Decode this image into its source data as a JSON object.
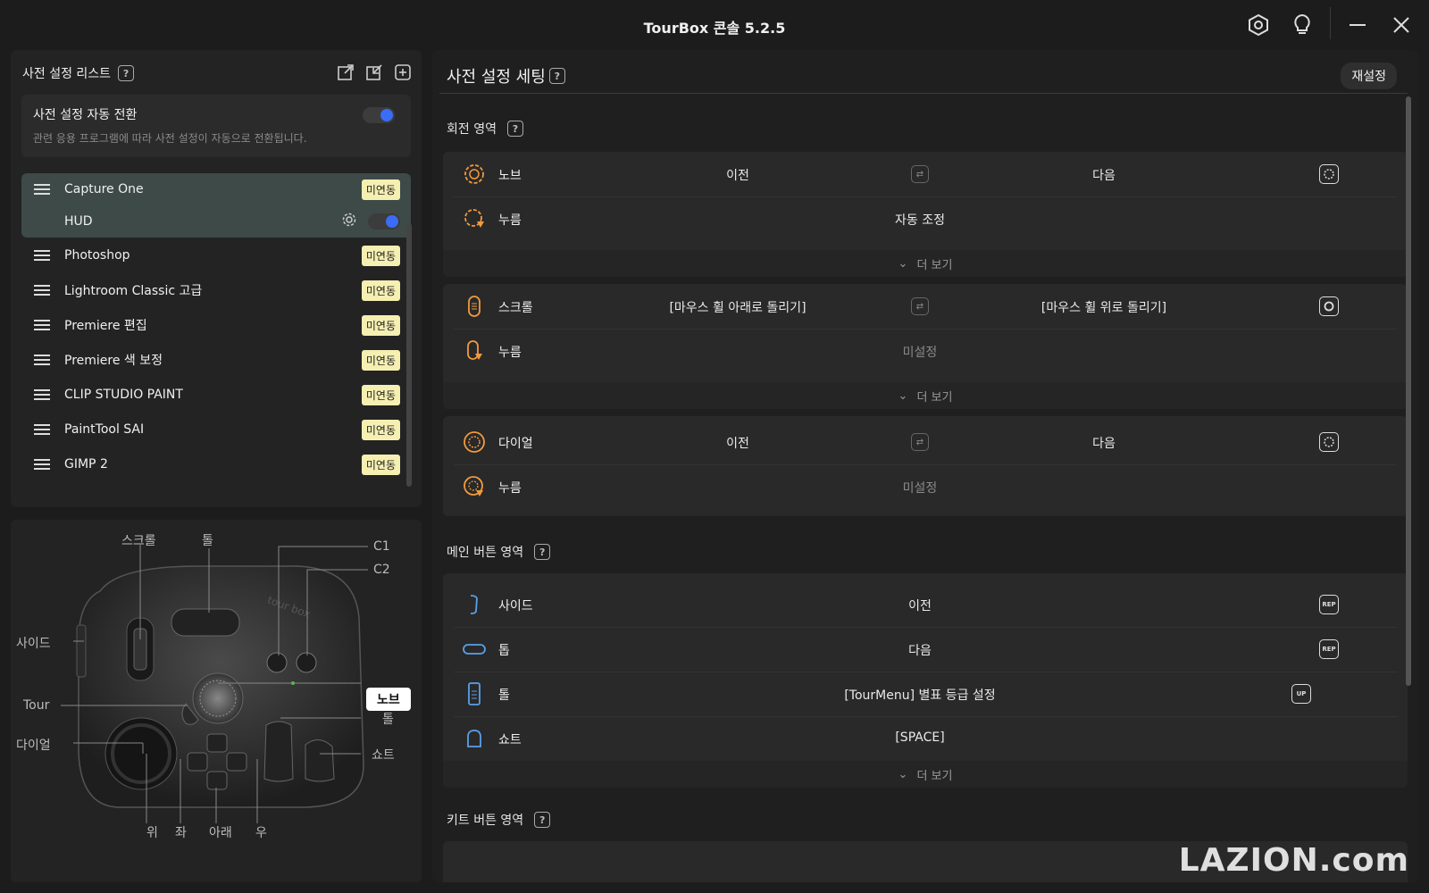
{
  "window": {
    "title": "TourBox 콘솔 5.2.5"
  },
  "presets": {
    "header": "사전 설정 리스트",
    "help": "?",
    "auto_switch": {
      "title": "사전 설정 자동 전환",
      "desc": "관련 응용 프로그램에 따라 사전 설정이 자동으로 전환됩니다."
    },
    "items": [
      {
        "name": "Capture One",
        "badge": "미연동"
      },
      {
        "name": "Photoshop",
        "badge": "미연동"
      },
      {
        "name": "Lightroom Classic 고급",
        "badge": "미연동"
      },
      {
        "name": "Premiere 편집",
        "badge": "미연동"
      },
      {
        "name": "Premiere 색 보정",
        "badge": "미연동"
      },
      {
        "name": "CLIP STUDIO PAINT",
        "badge": "미연동"
      },
      {
        "name": "PaintTool SAI",
        "badge": "미연동"
      },
      {
        "name": "GIMP 2",
        "badge": "미연동"
      }
    ],
    "hud_label": "HUD"
  },
  "device": {
    "labels": {
      "scroll": "스크롤",
      "tall": "톨",
      "c1": "C1",
      "c2": "C2",
      "side": "사이드",
      "knob": "노브",
      "tour": "Tour",
      "tall2": "톨",
      "dial": "다이얼",
      "short": "쇼트",
      "up": "위",
      "left": "좌",
      "down": "아래",
      "right": "우"
    },
    "logo": "tour box"
  },
  "settings": {
    "header": "사전 설정 세팅",
    "reset": "재설정",
    "help": "?",
    "rotation_section": "회전 영역",
    "main_section": "메인 버튼 영역",
    "kit_section": "키트 버튼 영역",
    "more": "더 보기",
    "knob": {
      "label": "노브",
      "left": "이전",
      "right": "다음",
      "press_label": "누름",
      "press_value": "자동 조정"
    },
    "scroll": {
      "label": "스크롤",
      "left": "[마우스 휠 아래로 돌리기]",
      "right": "[마우스 휠 위로 돌리기]",
      "press_label": "누름",
      "press_value": "미설정"
    },
    "dial": {
      "label": "다이얼",
      "left": "이전",
      "right": "다음",
      "press_label": "누름",
      "press_value": "미설정"
    },
    "main": [
      {
        "label": "사이드",
        "value": "이전",
        "tag": "REP"
      },
      {
        "label": "톱",
        "value": "다음",
        "tag": "REP"
      },
      {
        "label": "톨",
        "value": "[TourMenu] 별표 등급 설정",
        "tag": "UP"
      },
      {
        "label": "쇼트",
        "value": "[SPACE]",
        "tag": ""
      }
    ]
  },
  "watermark": "LAZION.com",
  "colors": {
    "accent": "#3b6cf5",
    "orange": "#f29a3f",
    "badge": "#f5efb2",
    "blue_icon": "#5aa0e8"
  }
}
